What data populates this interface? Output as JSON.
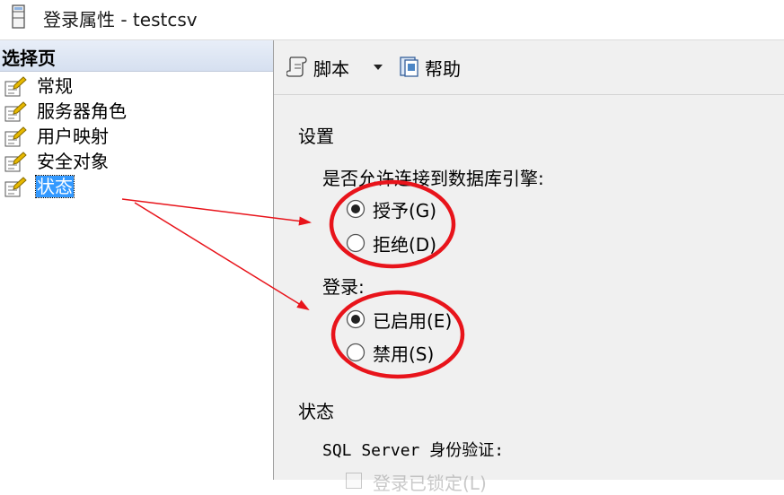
{
  "window": {
    "title": "登录属性 - testcsv"
  },
  "left_pane": {
    "header": "选择页",
    "items": [
      {
        "label": "常规",
        "selected": false
      },
      {
        "label": "服务器角色",
        "selected": false
      },
      {
        "label": "用户映射",
        "selected": false
      },
      {
        "label": "安全对象",
        "selected": false
      },
      {
        "label": "状态",
        "selected": true
      }
    ]
  },
  "toolbar": {
    "script_label": "脚本",
    "help_label": "帮助"
  },
  "settings": {
    "title": "设置",
    "connect_question": "是否允许连接到数据库引擎:",
    "grant_label": "授予(G)",
    "deny_label": "拒绝(D)",
    "grant_selected": true,
    "login_label": "登录:",
    "enabled_label": "已启用(E)",
    "disabled_label": "禁用(S)",
    "enabled_selected": true
  },
  "status": {
    "title": "状态",
    "auth_label": "SQL Server 身份验证:",
    "locked_label": "登录已锁定(L)"
  },
  "colors": {
    "annotation": "#e8141b",
    "selection": "#3399ff"
  }
}
